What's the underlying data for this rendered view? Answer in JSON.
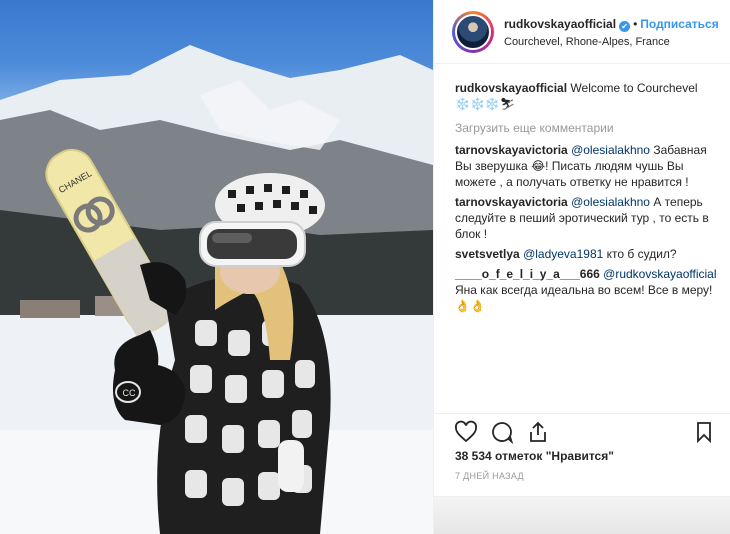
{
  "post": {
    "username": "rudkovskayaofficial",
    "verified_mark": "✔",
    "separator": "•",
    "follow_label": "Подписаться",
    "location": "Courchevel, Rhone-Alpes, France"
  },
  "caption": {
    "username": "rudkovskayaofficial",
    "text": "Welcome to Courchevel",
    "emoji": "❄️❄️❄️⛷"
  },
  "load_more_label": "Загрузить еще комментарии",
  "comments": [
    {
      "username": "tarnovskayavictoria",
      "mention": "@olesialakhno",
      "text": "Забавная Вы зверушка 😂! Писать людям чушь Вы можете , а получать ответку не нравится !"
    },
    {
      "username": "tarnovskayavictoria",
      "mention": "@olesialakhno",
      "text": "А теперь следуйте в пеший эротический тур , то есть в блок !"
    },
    {
      "username": "svetsvetlya",
      "mention": "@ladyeva1981",
      "text": "кто б судил?"
    },
    {
      "username": "____o_f_e_l_i_y_a___666",
      "mention": "@rudkovskayaofficial",
      "text": "Яна как всегда идеальна во всем! Все в меру!👌👌"
    }
  ],
  "likes_text": "38 534 отметок \"Нравится\"",
  "timestamp": "7 ДНЕЙ НАЗАД",
  "photo": {
    "ski_brand": "CHANEL",
    "glove_brand": "CC"
  },
  "icons": {
    "like": "heart-icon",
    "comment": "comment-icon",
    "share": "share-icon",
    "save": "bookmark-icon"
  }
}
